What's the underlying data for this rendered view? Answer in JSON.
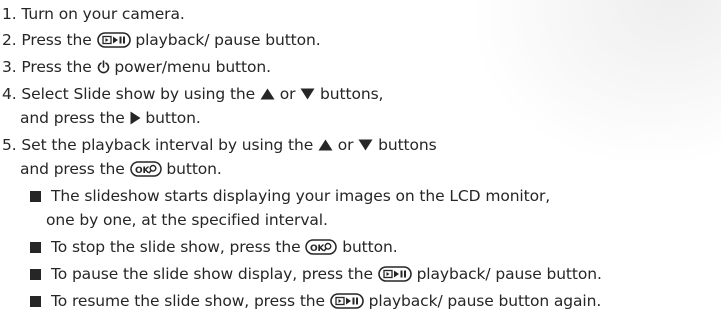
{
  "steps": [
    {
      "num": "1.",
      "text": "Turn on your camera."
    },
    {
      "num": "2.",
      "text_before": "Press the",
      "icon": "playback-pause-icon",
      "text_after": "playback/ pause button."
    },
    {
      "num": "3.",
      "text_before": "Press the",
      "icon": "power-icon",
      "text_after": "power/menu button."
    },
    {
      "num": "4.",
      "line1_before": "Select Slide show by using the",
      "icon_up": "up-arrow-icon",
      "or": "or",
      "icon_down": "down-arrow-icon",
      "line1_after": "buttons,",
      "line2_before": "and press the",
      "icon_right": "right-arrow-icon",
      "line2_after": "button."
    },
    {
      "num": "5.",
      "line1_before": "Set the playback interval by using the",
      "icon_up": "up-arrow-icon",
      "or": "or",
      "icon_down": "down-arrow-icon",
      "line1_after": "buttons",
      "line2_before": "and press the",
      "icon_ok": "ok-button-icon",
      "line2_after": "button."
    }
  ],
  "bullets": [
    {
      "line1": "The slideshow starts displaying your images on the LCD monitor,",
      "line2": "one by one, at the specified interval."
    },
    {
      "before": "To stop the slide show, press the",
      "icon": "ok-button-icon",
      "after": "button."
    },
    {
      "before": "To pause the slide show display, press the",
      "icon": "playback-pause-icon",
      "after": "playback/ pause button."
    },
    {
      "before": "To resume the slide show, press the",
      "icon": "playback-pause-icon",
      "after": "playback/ pause button again."
    }
  ]
}
